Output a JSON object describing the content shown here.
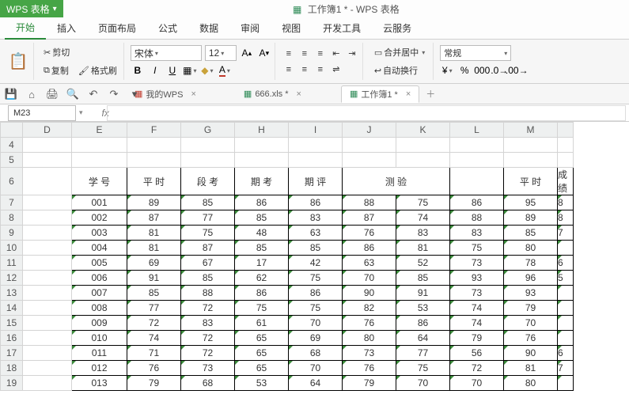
{
  "title": {
    "product_fragment": "WPS 表格",
    "window_title": "工作簿1 * - WPS 表格"
  },
  "menu": {
    "items": [
      "开始",
      "插入",
      "页面布局",
      "公式",
      "数据",
      "审阅",
      "视图",
      "开发工具",
      "云服务"
    ],
    "active_index": 0
  },
  "ribbon": {
    "cut": "剪切",
    "copy": "复制",
    "format_painter": "格式刷",
    "font_name": "宋体",
    "font_size": "12",
    "merge": "合并居中",
    "wrap": "自动换行",
    "number_format": "常规"
  },
  "file_tabs": {
    "tabs": [
      {
        "label": "我的WPS",
        "icon_color": "#c0392b"
      },
      {
        "label": "666.xls *",
        "icon_color": "#2e8b57"
      },
      {
        "label": "工作簿1 *",
        "icon_color": "#2e8b57"
      }
    ],
    "active_index": 2
  },
  "cell_ref": "M23",
  "columns": [
    "D",
    "E",
    "F",
    "G",
    "H",
    "I",
    "J",
    "K",
    "L",
    "M"
  ],
  "selected_column": "M",
  "first_row_number": 4,
  "headers_row": 6,
  "headers": {
    "E": "学 号",
    "F": "平 时",
    "G": "段 考",
    "H": "期 考",
    "I": "期 评",
    "JK": "测    验",
    "M": "平 时",
    "N": "成 绩"
  },
  "rows": [
    {
      "n": 7,
      "E": "001",
      "F": "89",
      "G": "85",
      "H": "86",
      "I": "86",
      "J": "88",
      "K": "75",
      "L": "86",
      "M": "95",
      "N": "8"
    },
    {
      "n": 8,
      "E": "002",
      "F": "87",
      "G": "77",
      "H": "85",
      "I": "83",
      "J": "87",
      "K": "74",
      "L": "88",
      "M": "89",
      "N": "8"
    },
    {
      "n": 9,
      "E": "003",
      "F": "81",
      "G": "75",
      "H": "48",
      "I": "63",
      "J": "76",
      "K": "83",
      "L": "83",
      "M": "85",
      "N": "7"
    },
    {
      "n": 10,
      "E": "004",
      "F": "81",
      "G": "87",
      "H": "85",
      "I": "85",
      "J": "86",
      "K": "81",
      "L": "75",
      "M": "80",
      "N": ""
    },
    {
      "n": 11,
      "E": "005",
      "F": "69",
      "G": "67",
      "H": "17",
      "I": "42",
      "J": "63",
      "K": "52",
      "L": "73",
      "M": "78",
      "N": "6"
    },
    {
      "n": 12,
      "E": "006",
      "F": "91",
      "G": "85",
      "H": "62",
      "I": "75",
      "J": "70",
      "K": "85",
      "L": "93",
      "M": "96",
      "N": "5"
    },
    {
      "n": 13,
      "E": "007",
      "F": "85",
      "G": "88",
      "H": "86",
      "I": "86",
      "J": "90",
      "K": "91",
      "L": "73",
      "M": "93",
      "N": ""
    },
    {
      "n": 14,
      "E": "008",
      "F": "77",
      "G": "72",
      "H": "75",
      "I": "75",
      "J": "82",
      "K": "53",
      "L": "74",
      "M": "79",
      "N": ""
    },
    {
      "n": 15,
      "E": "009",
      "F": "72",
      "G": "83",
      "H": "61",
      "I": "70",
      "J": "76",
      "K": "86",
      "L": "74",
      "M": "70",
      "N": ""
    },
    {
      "n": 16,
      "E": "010",
      "F": "74",
      "G": "72",
      "H": "65",
      "I": "69",
      "J": "80",
      "K": "64",
      "L": "79",
      "M": "76",
      "N": ""
    },
    {
      "n": 17,
      "E": "011",
      "F": "71",
      "G": "72",
      "H": "65",
      "I": "68",
      "J": "73",
      "K": "77",
      "L": "56",
      "M": "90",
      "N": "6"
    },
    {
      "n": 18,
      "E": "012",
      "F": "76",
      "G": "73",
      "H": "65",
      "I": "70",
      "J": "76",
      "K": "75",
      "L": "72",
      "M": "81",
      "N": "7"
    },
    {
      "n": 19,
      "E": "013",
      "F": "79",
      "G": "68",
      "H": "53",
      "I": "64",
      "J": "79",
      "K": "70",
      "L": "70",
      "M": "80",
      "N": ""
    }
  ]
}
